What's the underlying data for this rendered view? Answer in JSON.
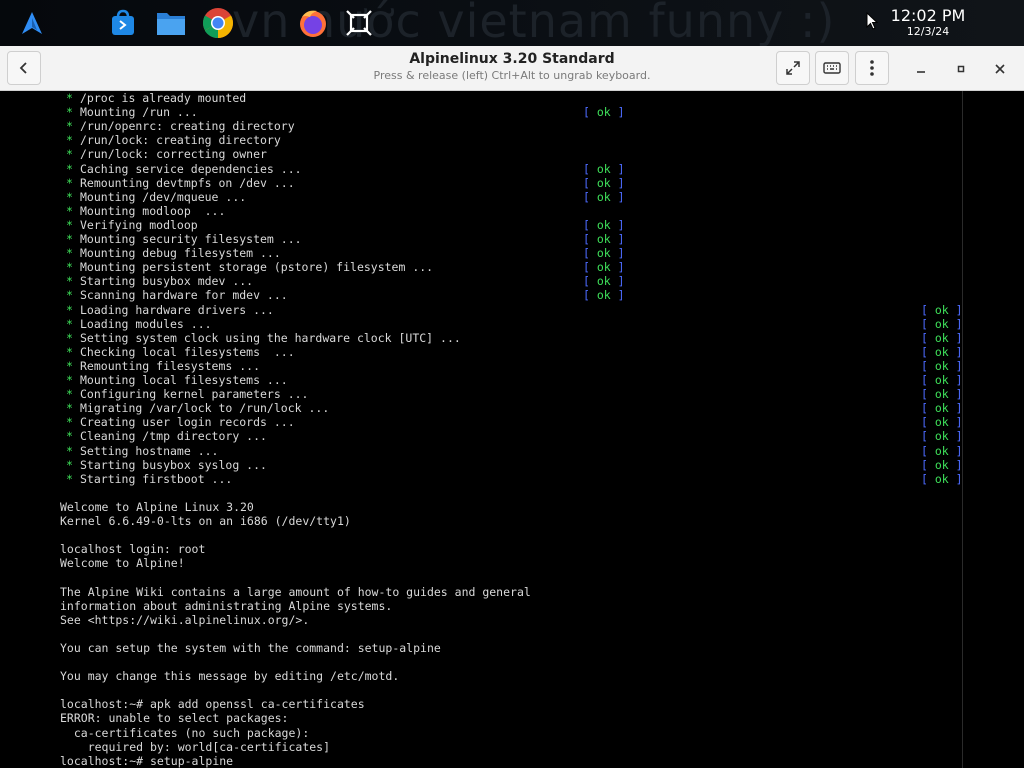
{
  "taskbar": {
    "wallpaper_text": "vn nước vietnam funny :)",
    "clock_time": "12:02 PM",
    "clock_date": "12/3/24",
    "apps": [
      "launcher-icon",
      "store-icon",
      "files-icon",
      "chrome-icon",
      "firefox-icon",
      "screenshot-icon"
    ]
  },
  "window": {
    "title": "Alpinelinux 3.20 Standard",
    "subtitle": "Press & release (left) Ctrl+Alt to ungrab keyboard."
  },
  "colors": {
    "ok_green": "#3ee05a",
    "bracket_blue": "#4d6bff",
    "terminal_text": "#d9d9d9"
  },
  "terminal": {
    "ok_label": "ok",
    "boot_lines": [
      {
        "text": "/proc is already mounted",
        "ok": "none"
      },
      {
        "text": "Mounting /run ...",
        "ok": "mid"
      },
      {
        "text": "/run/openrc: creating directory",
        "ok": "none"
      },
      {
        "text": "/run/lock: creating directory",
        "ok": "none"
      },
      {
        "text": "/run/lock: correcting owner",
        "ok": "none"
      },
      {
        "text": "Caching service dependencies ...",
        "ok": "mid"
      },
      {
        "text": "Remounting devtmpfs on /dev ...",
        "ok": "mid"
      },
      {
        "text": "Mounting /dev/mqueue ...",
        "ok": "mid"
      },
      {
        "text": "Mounting modloop  ...",
        "ok": "none"
      },
      {
        "text": "Verifying modloop",
        "ok": "mid"
      },
      {
        "text": "Mounting security filesystem ...",
        "ok": "mid"
      },
      {
        "text": "Mounting debug filesystem ...",
        "ok": "mid"
      },
      {
        "text": "Mounting persistent storage (pstore) filesystem ...",
        "ok": "mid"
      },
      {
        "text": "Starting busybox mdev ...",
        "ok": "mid"
      },
      {
        "text": "Scanning hardware for mdev ...",
        "ok": "mid"
      },
      {
        "text": "Loading hardware drivers ...",
        "ok": "right"
      },
      {
        "text": "Loading modules ...",
        "ok": "right"
      },
      {
        "text": "Setting system clock using the hardware clock [UTC] ...",
        "ok": "right"
      },
      {
        "text": "Checking local filesystems  ...",
        "ok": "right"
      },
      {
        "text": "Remounting filesystems ...",
        "ok": "right"
      },
      {
        "text": "Mounting local filesystems ...",
        "ok": "right"
      },
      {
        "text": "Configuring kernel parameters ...",
        "ok": "right"
      },
      {
        "text": "Migrating /var/lock to /run/lock ...",
        "ok": "right"
      },
      {
        "text": "Creating user login records ...",
        "ok": "right"
      },
      {
        "text": "Cleaning /tmp directory ...",
        "ok": "right"
      },
      {
        "text": "Setting hostname ...",
        "ok": "right"
      },
      {
        "text": "Starting busybox syslog ...",
        "ok": "right"
      },
      {
        "text": "Starting firstboot ...",
        "ok": "right"
      }
    ],
    "after_lines": [
      "",
      "Welcome to Alpine Linux 3.20",
      "Kernel 6.6.49-0-lts on an i686 (/dev/tty1)",
      "",
      "localhost login: root",
      "Welcome to Alpine!",
      "",
      "The Alpine Wiki contains a large amount of how-to guides and general",
      "information about administrating Alpine systems.",
      "See <https://wiki.alpinelinux.org/>.",
      "",
      "You can setup the system with the command: setup-alpine",
      "",
      "You may change this message by editing /etc/motd.",
      "",
      "localhost:~# apk add openssl ca-certificates",
      "ERROR: unable to select packages:",
      "  ca-certificates (no such package):",
      "    required by: world[ca-certificates]",
      "localhost:~# setup-alpine"
    ]
  }
}
